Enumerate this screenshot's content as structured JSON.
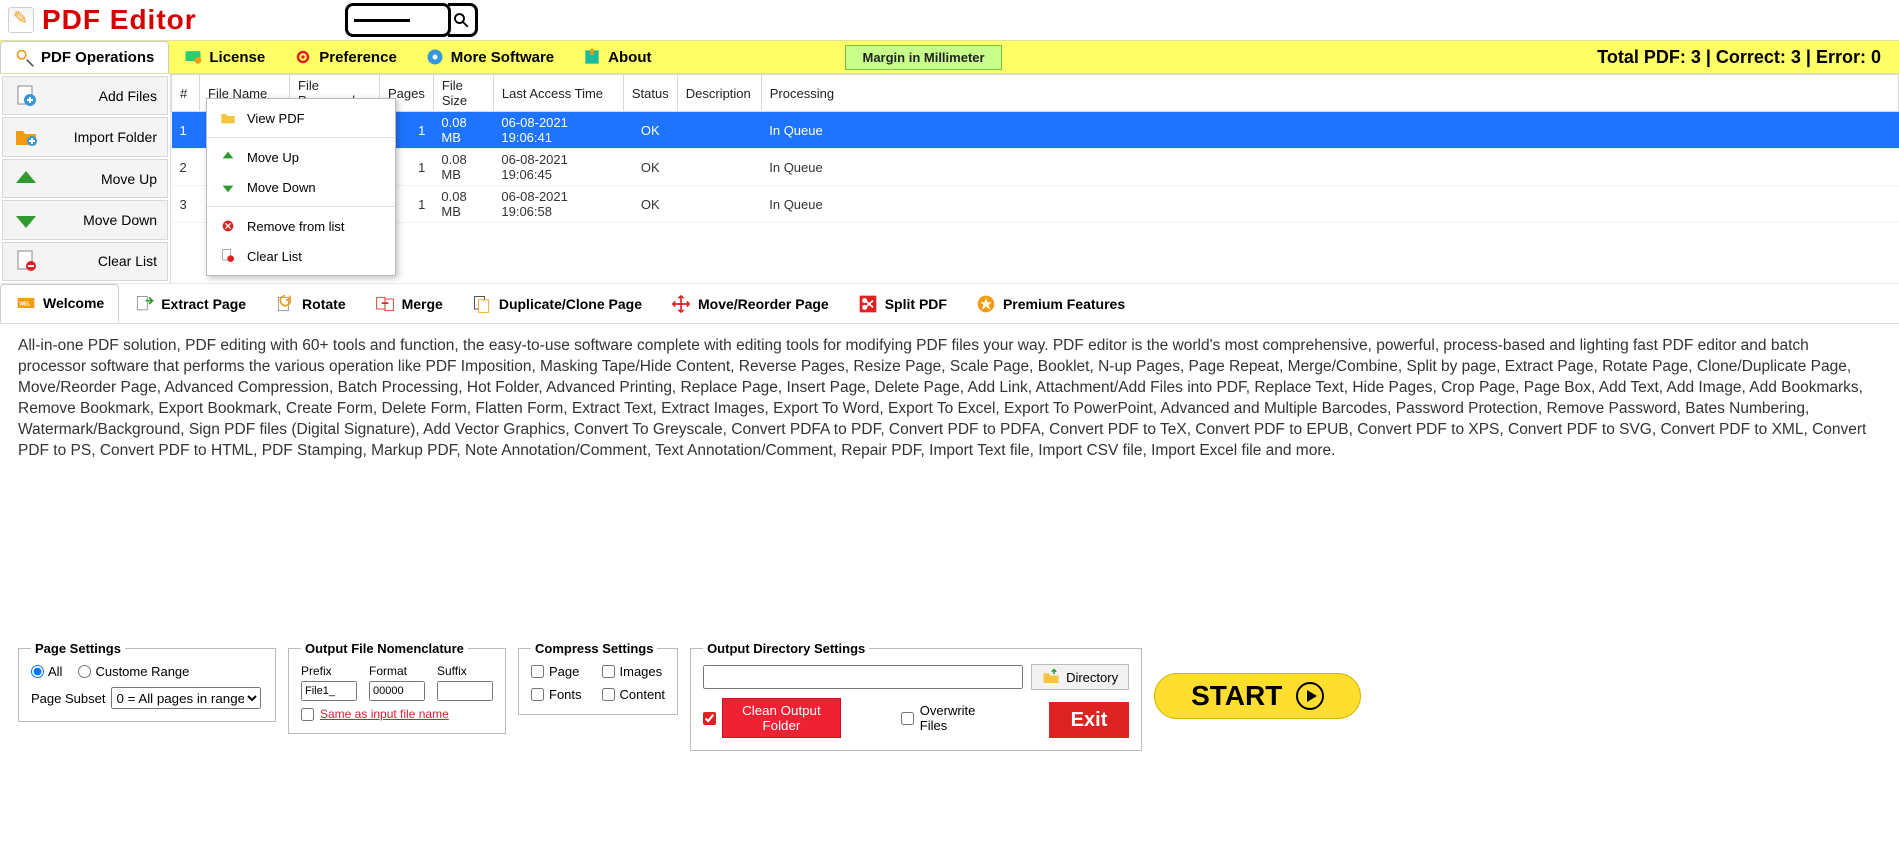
{
  "app": {
    "title": "PDF Editor"
  },
  "menu": {
    "pdf_operations": "PDF Operations",
    "license": "License",
    "preference": "Preference",
    "more_software": "More Software",
    "about": "About",
    "margin_badge": "Margin in Millimeter"
  },
  "status_line": "Total PDF: 3  |  Correct: 3  |  Error: 0",
  "sidebar": {
    "add_files": "Add Files",
    "import_folder": "Import Folder",
    "move_up": "Move Up",
    "move_down": "Move Down",
    "clear_list": "Clear List"
  },
  "grid": {
    "cols": {
      "num": "#",
      "filename": "File Name",
      "filepassword": "File Password",
      "pages": "Pages",
      "filesize": "File Size",
      "lastaccess": "Last Access Time",
      "status": "Status",
      "description": "Description",
      "processing": "Processing"
    },
    "rows": [
      {
        "num": "1",
        "pages": "1",
        "size": "0.08 MB",
        "time": "06-08-2021 19:06:41",
        "status": "OK",
        "processing": "In Queue"
      },
      {
        "num": "2",
        "pages": "1",
        "size": "0.08 MB",
        "time": "06-08-2021 19:06:45",
        "status": "OK",
        "processing": "In Queue"
      },
      {
        "num": "3",
        "pages": "1",
        "size": "0.08 MB",
        "time": "06-08-2021 19:06:58",
        "status": "OK",
        "processing": "In Queue"
      }
    ]
  },
  "ctx": {
    "view_pdf": "View PDF",
    "move_up": "Move Up",
    "move_down": "Move Down",
    "remove": "Remove from list",
    "clear": "Clear List"
  },
  "tabs": {
    "welcome": "Welcome",
    "extract": "Extract Page",
    "rotate": "Rotate",
    "merge": "Merge",
    "duplicate": "Duplicate/Clone Page",
    "move": "Move/Reorder Page",
    "split": "Split PDF",
    "premium": "Premium Features"
  },
  "description": "All-in-one PDF solution, PDF editing with 60+ tools and function, the easy-to-use software complete with editing tools for modifying PDF files your way. PDF editor is the world's most comprehensive, powerful, process-based and lighting fast PDF editor and batch processor software that performs the various operation like PDF Imposition, Masking Tape/Hide Content, Reverse Pages, Resize Page, Scale Page, Booklet, N-up Pages, Page Repeat, Merge/Combine, Split by page, Extract Page, Rotate Page, Clone/Duplicate Page, Move/Reorder Page, Advanced Compression, Batch Processing, Hot Folder, Advanced Printing, Replace Page, Insert Page, Delete Page, Add Link, Attachment/Add Files into PDF, Replace Text, Hide Pages, Crop Page, Page Box, Add Text, Add Image, Add Bookmarks, Remove Bookmark, Export Bookmark, Create Form, Delete Form, Flatten Form, Extract Text, Extract Images, Export To Word, Export To Excel, Export To PowerPoint, Advanced and Multiple Barcodes, Password Protection, Remove Password, Bates Numbering,  Watermark/Background, Sign PDF files (Digital Signature), Add Vector Graphics, Convert To Greyscale, Convert PDFA to PDF, Convert PDF to PDFA, Convert PDF to TeX, Convert PDF to EPUB, Convert PDF to XPS, Convert PDF to SVG, Convert PDF to XML, Convert PDF to PS, Convert PDF to HTML, PDF Stamping, Markup PDF, Note Annotation/Comment, Text Annotation/Comment, Repair PDF, Import Text file, Import CSV file, Import Excel file and more.",
  "page_settings": {
    "legend": "Page Settings",
    "all": "All",
    "custom": "Custome Range",
    "subset_label": "Page Subset",
    "subset_value": "0 = All pages in range"
  },
  "nomen": {
    "legend": "Output File Nomenclature",
    "prefix_label": "Prefix",
    "format_label": "Format",
    "suffix_label": "Suffix",
    "prefix_value": "File1_",
    "format_value": "00000",
    "suffix_value": "",
    "same": "Same as input file name"
  },
  "compress": {
    "legend": "Compress Settings",
    "page": "Page",
    "images": "Images",
    "fonts": "Fonts",
    "content": "Content"
  },
  "outdir": {
    "legend": "Output Directory Settings",
    "directory_btn": "Directory",
    "clean_btn": "Clean Output Folder",
    "overwrite": "Overwrite Files",
    "path": ""
  },
  "exit": "Exit",
  "start": "START"
}
